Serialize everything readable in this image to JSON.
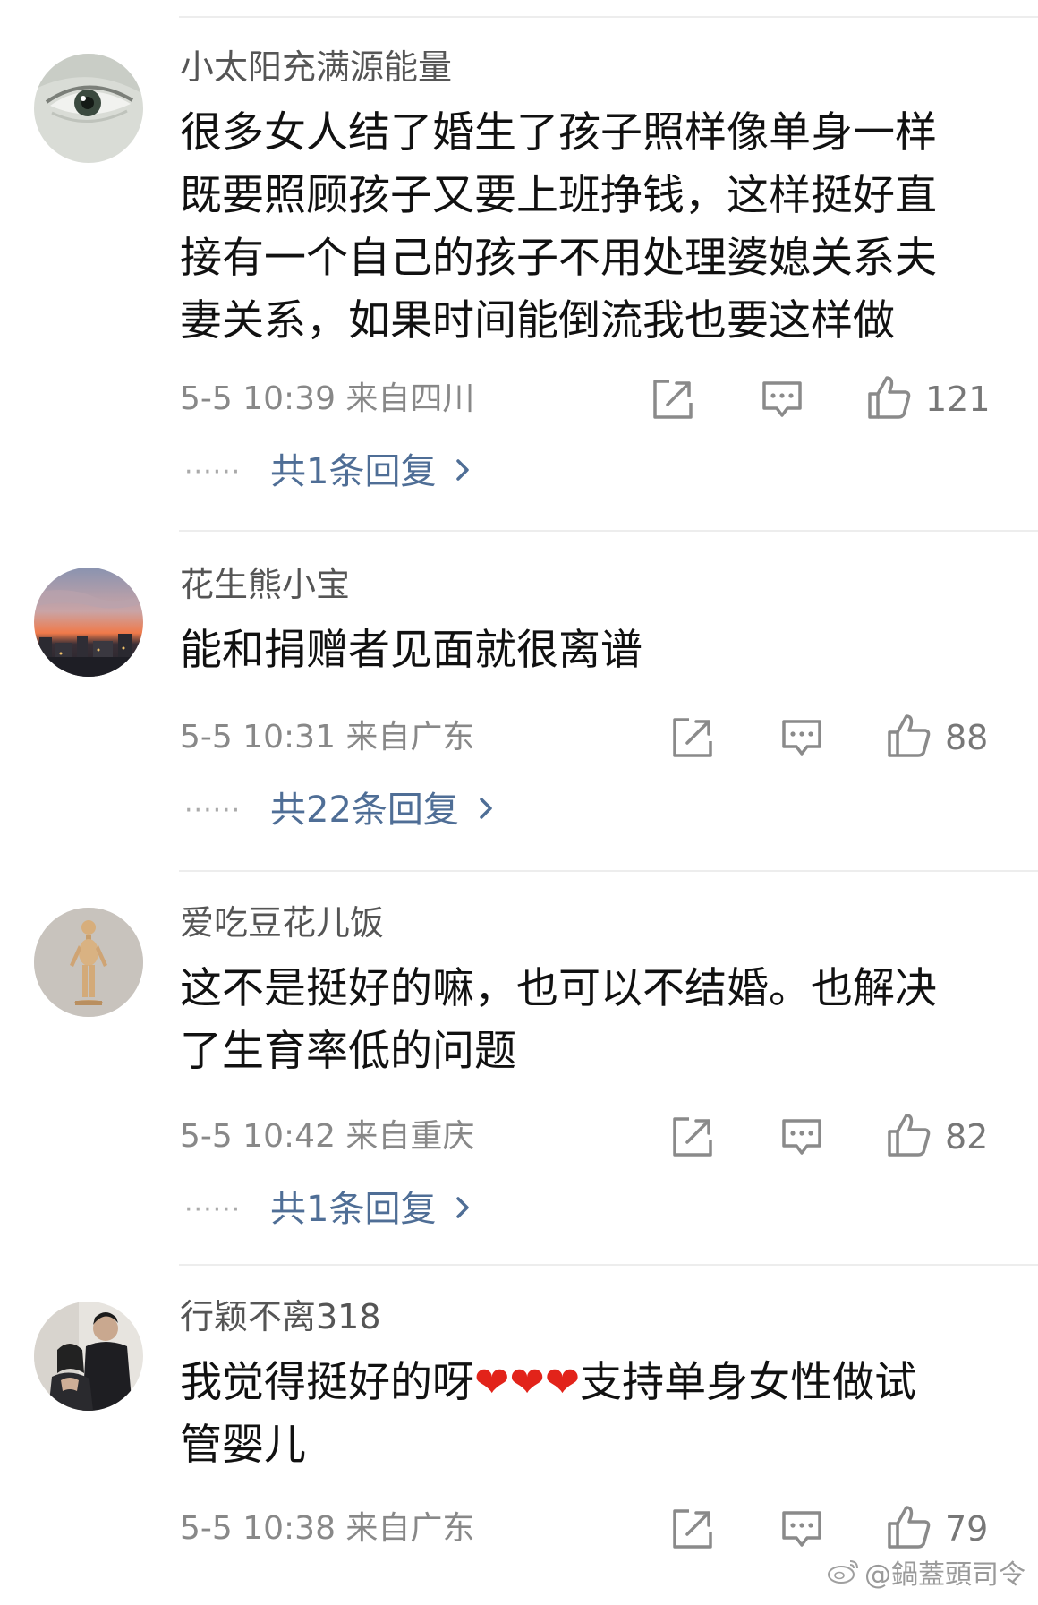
{
  "comments": [
    {
      "username": "小太阳充满源能量",
      "lines": [
        "很多女人结了婚生了孩子照样像单身一样",
        "既要照顾孩子又要上班挣钱，这样挺好直",
        "接有一个自己的孩子不用处理婆媳关系夫",
        "妻关系，如果时间能倒流我也要这样做"
      ],
      "meta": "5-5 10:39  来自四川",
      "likes": "121",
      "replies": "共1条回复",
      "avatar_icon": "eye-photo"
    },
    {
      "username": "花生熊小宝",
      "lines": [
        "能和捐赠者见面就很离谱"
      ],
      "meta": "5-5 10:31  来自广东",
      "likes": "88",
      "replies": "共22条回复",
      "avatar_icon": "sunset-city-photo"
    },
    {
      "username": "爱吃豆花儿饭",
      "lines": [
        "这不是挺好的嘛，也可以不结婚。也解决",
        "了生育率低的问题"
      ],
      "meta": "5-5 10:42  来自重庆",
      "likes": "82",
      "replies": "共1条回复",
      "avatar_icon": "wooden-figure-photo"
    },
    {
      "username": "行颖不离318",
      "lines_rich": [
        {
          "before": "我觉得挺好的呀",
          "hearts": "❤❤❤",
          "after": "支持单身女性做试"
        },
        {
          "before": "管婴儿",
          "hearts": "",
          "after": ""
        }
      ],
      "meta": "5-5 10:38  来自广东",
      "likes": "79",
      "avatar_icon": "couple-photo"
    }
  ],
  "watermark": "@鍋蓋頭司令",
  "colors": {
    "reply_link": "#4f6e96",
    "meta": "#888888",
    "username": "#555555",
    "heart": "#e2231a"
  }
}
